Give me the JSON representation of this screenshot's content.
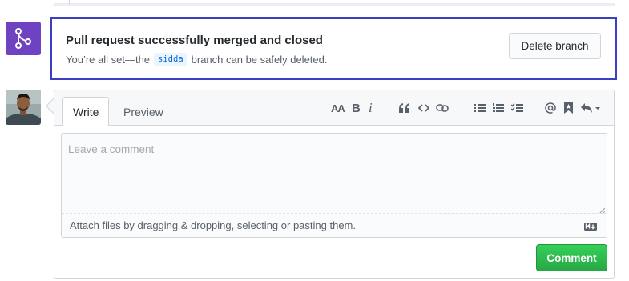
{
  "merge_status": {
    "badge_icon": "git-merge-icon",
    "badge_color": "#6f42c1",
    "highlight_color": "#3b3fc2",
    "title": "Pull request successfully merged and closed",
    "desc_prefix": "You’re all set—the",
    "branch_name": "sidda",
    "desc_suffix": "branch can be safely deleted.",
    "delete_button_label": "Delete branch"
  },
  "comment_form": {
    "avatar": "user-avatar",
    "tabs": [
      {
        "label": "Write",
        "active": true
      },
      {
        "label": "Preview",
        "active": false
      }
    ],
    "toolbar": {
      "heading_label": "AA",
      "bold_label": "B",
      "italic_label": "i",
      "icons": [
        "heading-icon",
        "bold-icon",
        "italic-icon",
        "quote-icon",
        "code-icon",
        "link-icon",
        "bulleted-list-icon",
        "numbered-list-icon",
        "task-list-icon",
        "mention-icon",
        "saved-reply-icon",
        "reply-dropdown-icon"
      ]
    },
    "placeholder": "Leave a comment",
    "attach_text": "Attach files by dragging & dropping, selecting or pasting them.",
    "markdown_icon": "markdown-icon",
    "submit_label": "Comment",
    "submit_color": "#2ea44f"
  }
}
